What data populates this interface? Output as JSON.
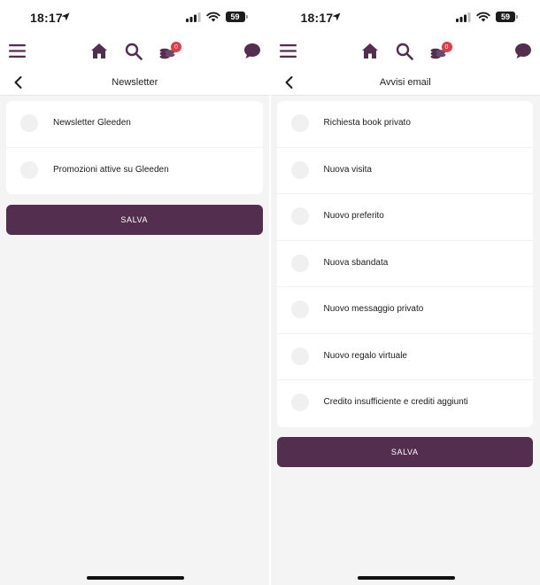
{
  "colors": {
    "brand": "#532e4f",
    "badge": "#e23b47",
    "background": "#f4f4f4"
  },
  "screens": [
    {
      "status": {
        "time": "18:17",
        "battery": "59"
      },
      "nav": {
        "icons": [
          "menu-icon",
          "home-icon",
          "search-icon",
          "credits-icon",
          "chat-icon"
        ],
        "credits_badge": "0"
      },
      "title": "Newsletter",
      "options": [
        {
          "label": "Newsletter Gleeden",
          "checked": false
        },
        {
          "label": "Promozioni attive su Gleeden",
          "checked": false
        }
      ],
      "save_label": "SALVA"
    },
    {
      "status": {
        "time": "18:17",
        "battery": "59"
      },
      "nav": {
        "icons": [
          "menu-icon",
          "home-icon",
          "search-icon",
          "credits-icon",
          "chat-icon"
        ],
        "credits_badge": "0"
      },
      "title": "Avvisi email",
      "options": [
        {
          "label": "Richiesta book privato",
          "checked": false
        },
        {
          "label": "Nuova visita",
          "checked": false
        },
        {
          "label": "Nuovo preferito",
          "checked": false
        },
        {
          "label": "Nuova sbandata",
          "checked": false
        },
        {
          "label": "Nuovo messaggio privato",
          "checked": false
        },
        {
          "label": "Nuovo regalo virtuale",
          "checked": false
        },
        {
          "label": "Credito insufficiente e crediti aggiunti",
          "checked": false
        }
      ],
      "save_label": "SALVA"
    }
  ]
}
